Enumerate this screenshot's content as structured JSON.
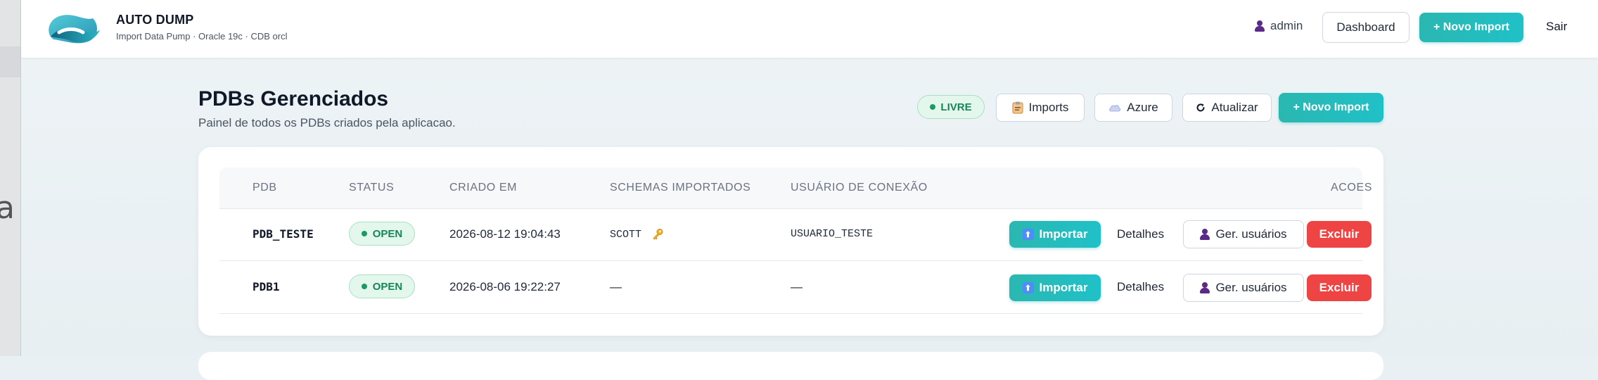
{
  "header": {
    "brand_title": "AUTO DUMP",
    "brand_subtitle": "Import Data Pump · Oracle 19c · CDB orcl",
    "user": "admin",
    "dashboard_label": "Dashboard",
    "novo_import_label": "+ Novo Import",
    "sair_label": "Sair"
  },
  "page": {
    "title": "PDBs Gerenciados",
    "subtitle": "Painel de todos os PDBs criados pela aplicacao.",
    "status_pill": "LIVRE",
    "actions": {
      "imports": "Imports",
      "azure": "Azure",
      "atualizar": "Atualizar",
      "novo_import": "+ Novo Import"
    }
  },
  "table": {
    "columns": [
      "PDB",
      "STATUS",
      "CRIADO EM",
      "SCHEMAS IMPORTADOS",
      "USUÁRIO DE CONEXÃO",
      "ACOES"
    ],
    "rows": [
      {
        "pdb": "PDB_TESTE",
        "status": "OPEN",
        "criado_em": "2026-08-12 19:04:43",
        "schemas": "SCOTT",
        "usuario": "USUARIO_TESTE",
        "importar": "Importar",
        "detalhes": "Detalhes",
        "ger_usuarios": "Ger. usuários",
        "excluir": "Excluir"
      },
      {
        "pdb": "PDB1",
        "status": "OPEN",
        "criado_em": "2026-08-06 19:22:27",
        "schemas": "—",
        "usuario": "—",
        "importar": "Importar",
        "detalhes": "Detalhes",
        "ger_usuarios": "Ger. usuários",
        "excluir": "Excluir"
      }
    ]
  },
  "colors": {
    "accent_teal": "#1fc1c8",
    "danger": "#ef4444",
    "success": "#16865a"
  }
}
